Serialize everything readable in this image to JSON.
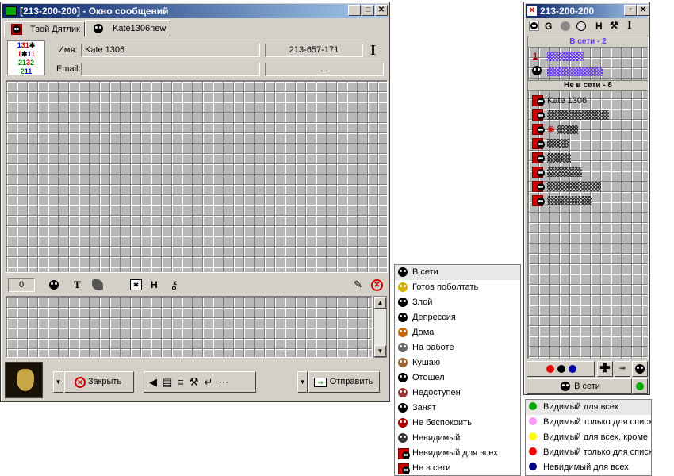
{
  "chat": {
    "title": "[213-200-200] - Окно сообщений",
    "tabs": [
      "Твой Дятлик",
      "Kate1306new"
    ],
    "name_label": "Имя:",
    "name_value": "Kate  1306",
    "uin_value": "213-657-171",
    "email_label": "Email:",
    "email_value": "",
    "email_more": "...",
    "counter": "0",
    "close_label": "Закрыть",
    "send_label": "Отправить",
    "toolbar_letter_t": "T",
    "toolbar_letter_h": "H"
  },
  "contacts": {
    "title": "213-200-200",
    "online_header": "В сети - 2",
    "offline_header": "Не в сети - 8",
    "online_items": [
      "",
      ""
    ],
    "offline_items": [
      "Kate 1306",
      "",
      "",
      "",
      "",
      "",
      "",
      ""
    ],
    "status_button": "В сети",
    "toolbar_letter_g": "G",
    "toolbar_letter_h": "H",
    "toolbar_letter_i": "I"
  },
  "status_menu": {
    "items": [
      "В сети",
      "Готов поболтать",
      "Злой",
      "Депрессия",
      "Дома",
      "На работе",
      "Кушаю",
      "Отошел",
      "Недоступен",
      "Занят",
      "Не беспокоить",
      "Невидимый",
      "Невидимый для всех",
      "Не в сети"
    ]
  },
  "visibility_menu": {
    "items": [
      "Видимый для всех",
      "Видимый только для списка",
      "Видимый для всех, кроме",
      "Видимый только для списка",
      "Невидимый для всех"
    ],
    "colors": [
      "#00aa00",
      "#ff99ff",
      "#ffff00",
      "#ff0000",
      "#000080"
    ]
  }
}
